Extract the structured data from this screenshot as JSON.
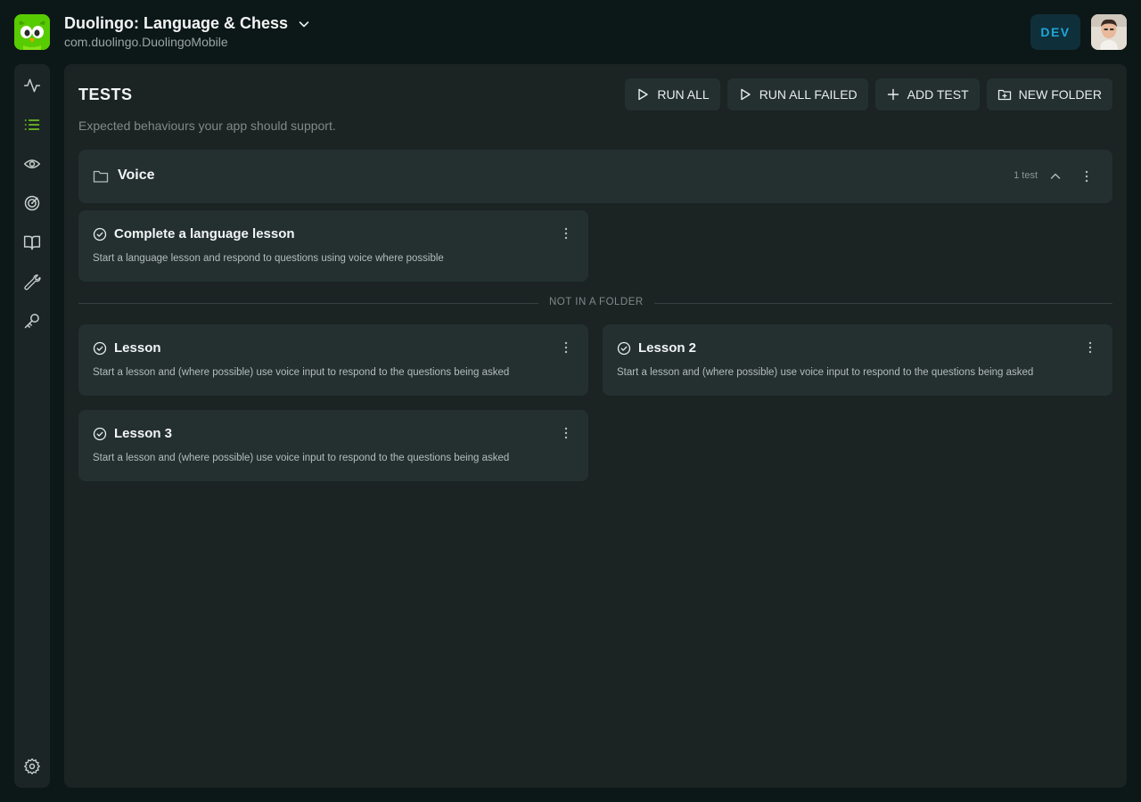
{
  "app": {
    "title": "Duolingo: Language & Chess",
    "bundle_id": "com.duolingo.DuolingoMobile",
    "environment": "DEV",
    "accent_color": "#58cc02"
  },
  "sidebar": {
    "items": [
      {
        "icon": "activity-icon",
        "active": false
      },
      {
        "icon": "list-icon",
        "active": true
      },
      {
        "icon": "eye-icon",
        "active": false
      },
      {
        "icon": "target-icon",
        "active": false
      },
      {
        "icon": "book-icon",
        "active": false
      },
      {
        "icon": "wrench-icon",
        "active": false
      },
      {
        "icon": "key-icon",
        "active": false
      }
    ],
    "footer_icon": "settings-icon",
    "active_color": "#7ed321"
  },
  "page": {
    "title": "TESTS",
    "subtitle": "Expected behaviours your app should support."
  },
  "toolbar": {
    "run_all": "RUN ALL",
    "run_all_failed": "RUN ALL FAILED",
    "add_test": "ADD TEST",
    "new_folder": "NEW FOLDER"
  },
  "folders": [
    {
      "name": "Voice",
      "count_label": "1 test",
      "expanded": true,
      "tests": [
        {
          "title": "Complete a language lesson",
          "description": "Start a language lesson and respond to questions using voice where possible"
        }
      ]
    }
  ],
  "unfiled": {
    "label": "NOT IN A FOLDER",
    "tests": [
      {
        "title": "Lesson",
        "description": "Start a lesson and (where possible) use voice input to respond to the questions being asked"
      },
      {
        "title": "Lesson 2",
        "description": "Start a lesson and (where possible) use voice input to respond to the questions being asked"
      },
      {
        "title": "Lesson 3",
        "description": "Start a lesson and (where possible) use voice input to respond to the questions being asked"
      }
    ]
  }
}
